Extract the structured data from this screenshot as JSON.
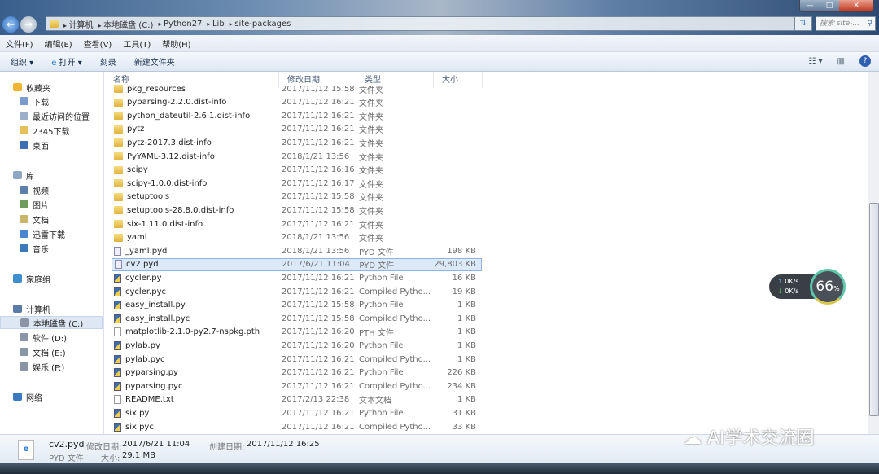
{
  "window": {
    "controls": [
      "minimize",
      "maximize",
      "close"
    ]
  },
  "address": {
    "segments": [
      "计算机",
      "本地磁盘 (C:)",
      "Python27",
      "Lib",
      "site-packages"
    ],
    "search_placeholder": "搜索 site-..."
  },
  "menu": [
    "文件(F)",
    "编辑(E)",
    "查看(V)",
    "工具(T)",
    "帮助(H)"
  ],
  "toolbar": {
    "organize": "组织 ▾",
    "open": "打开 ▾",
    "burn": "刻录",
    "new_folder": "新建文件夹"
  },
  "sidebar": [
    {
      "label": "收藏夹",
      "icon": "star-icon",
      "color": "#f2b531"
    },
    {
      "label": "下载",
      "icon": "download-folder-icon",
      "color": "#7a9ccc",
      "indent": true
    },
    {
      "label": "最近访问的位置",
      "icon": "recent-places-icon",
      "color": "#9aaecb",
      "indent": true
    },
    {
      "label": "2345下载",
      "icon": "folder-icon",
      "color": "#e7c157",
      "indent": true
    },
    {
      "label": "桌面",
      "icon": "desktop-icon",
      "color": "#3a6fb5",
      "indent": true
    },
    {
      "label": "库",
      "icon": "library-icon",
      "color": "#8fa7c5"
    },
    {
      "label": "视频",
      "icon": "video-icon",
      "color": "#5b7fae",
      "indent": true
    },
    {
      "label": "图片",
      "icon": "pictures-icon",
      "color": "#6f9b5a",
      "indent": true
    },
    {
      "label": "文档",
      "icon": "documents-icon",
      "color": "#c9b46a",
      "indent": true
    },
    {
      "label": "迅雷下载",
      "icon": "thunder-download-icon",
      "color": "#4a86cf",
      "indent": true
    },
    {
      "label": "音乐",
      "icon": "music-icon",
      "color": "#3b78c2",
      "indent": true
    },
    {
      "label": "家庭组",
      "icon": "homegroup-icon",
      "color": "#3f8fd0"
    },
    {
      "label": "计算机",
      "icon": "computer-icon",
      "color": "#5a7ca6"
    },
    {
      "label": "本地磁盘 (C:)",
      "icon": "drive-icon",
      "color": "#8a96a6",
      "indent": true,
      "selected": true
    },
    {
      "label": "软件 (D:)",
      "icon": "drive-icon",
      "color": "#8a96a6",
      "indent": true
    },
    {
      "label": "文档 (E:)",
      "icon": "drive-icon",
      "color": "#8a96a6",
      "indent": true
    },
    {
      "label": "娱乐 (F:)",
      "icon": "drive-icon",
      "color": "#8a96a6",
      "indent": true
    },
    {
      "label": "网络",
      "icon": "network-icon",
      "color": "#3a78c0"
    }
  ],
  "columns": [
    "名称",
    "修改日期",
    "类型",
    "大小"
  ],
  "files": [
    {
      "name": "pkg_resources",
      "date": "2017/11/12 15:58",
      "type": "文件夹",
      "size": "",
      "kind": "folder"
    },
    {
      "name": "pyparsing-2.2.0.dist-info",
      "date": "2017/11/12 16:21",
      "type": "文件夹",
      "size": "",
      "kind": "folder"
    },
    {
      "name": "python_dateutil-2.6.1.dist-info",
      "date": "2017/11/12 16:21",
      "type": "文件夹",
      "size": "",
      "kind": "folder"
    },
    {
      "name": "pytz",
      "date": "2017/11/12 16:21",
      "type": "文件夹",
      "size": "",
      "kind": "folder"
    },
    {
      "name": "pytz-2017.3.dist-info",
      "date": "2017/11/12 16:21",
      "type": "文件夹",
      "size": "",
      "kind": "folder"
    },
    {
      "name": "PyYAML-3.12.dist-info",
      "date": "2018/1/21 13:56",
      "type": "文件夹",
      "size": "",
      "kind": "folder"
    },
    {
      "name": "scipy",
      "date": "2017/11/12 16:16",
      "type": "文件夹",
      "size": "",
      "kind": "folder"
    },
    {
      "name": "scipy-1.0.0.dist-info",
      "date": "2017/11/12 16:17",
      "type": "文件夹",
      "size": "",
      "kind": "folder"
    },
    {
      "name": "setuptools",
      "date": "2017/11/12 15:58",
      "type": "文件夹",
      "size": "",
      "kind": "folder"
    },
    {
      "name": "setuptools-28.8.0.dist-info",
      "date": "2017/11/12 15:58",
      "type": "文件夹",
      "size": "",
      "kind": "folder"
    },
    {
      "name": "six-1.11.0.dist-info",
      "date": "2017/11/12 16:21",
      "type": "文件夹",
      "size": "",
      "kind": "folder"
    },
    {
      "name": "yaml",
      "date": "2018/1/21 13:56",
      "type": "文件夹",
      "size": "",
      "kind": "folder"
    },
    {
      "name": "_yaml.pyd",
      "date": "2018/1/21 13:56",
      "type": "PYD 文件",
      "size": "198 KB",
      "kind": "pyd"
    },
    {
      "name": "cv2.pyd",
      "date": "2017/6/21 11:04",
      "type": "PYD 文件",
      "size": "29,803 KB",
      "kind": "pyd",
      "selected": true
    },
    {
      "name": "cycler.py",
      "date": "2017/11/12 16:21",
      "type": "Python File",
      "size": "16 KB",
      "kind": "py"
    },
    {
      "name": "cycler.pyc",
      "date": "2017/11/12 16:21",
      "type": "Compiled Pytho...",
      "size": "19 KB",
      "kind": "py"
    },
    {
      "name": "easy_install.py",
      "date": "2017/11/12 15:58",
      "type": "Python File",
      "size": "1 KB",
      "kind": "py"
    },
    {
      "name": "easy_install.pyc",
      "date": "2017/11/12 15:58",
      "type": "Compiled Pytho...",
      "size": "1 KB",
      "kind": "py"
    },
    {
      "name": "matplotlib-2.1.0-py2.7-nspkg.pth",
      "date": "2017/11/12 16:20",
      "type": "PTH 文件",
      "size": "1 KB",
      "kind": "file"
    },
    {
      "name": "pylab.py",
      "date": "2017/11/12 16:20",
      "type": "Python File",
      "size": "1 KB",
      "kind": "py"
    },
    {
      "name": "pylab.pyc",
      "date": "2017/11/12 16:21",
      "type": "Compiled Pytho...",
      "size": "1 KB",
      "kind": "py"
    },
    {
      "name": "pyparsing.py",
      "date": "2017/11/12 16:21",
      "type": "Python File",
      "size": "226 KB",
      "kind": "py"
    },
    {
      "name": "pyparsing.pyc",
      "date": "2017/11/12 16:21",
      "type": "Compiled Pytho...",
      "size": "234 KB",
      "kind": "py"
    },
    {
      "name": "README.txt",
      "date": "2017/2/13 22:38",
      "type": "文本文档",
      "size": "1 KB",
      "kind": "file"
    },
    {
      "name": "six.py",
      "date": "2017/11/12 16:21",
      "type": "Python File",
      "size": "31 KB",
      "kind": "py"
    },
    {
      "name": "six.pyc",
      "date": "2017/11/12 16:21",
      "type": "Compiled Pytho...",
      "size": "33 KB",
      "kind": "py"
    }
  ],
  "details": {
    "name": "cv2.pyd",
    "modified_label": "修改日期:",
    "modified": "2017/6/21 11:04",
    "created_label": "创建日期:",
    "created": "2017/11/12 16:25",
    "type": "PYD 文件",
    "size_label": "大小:",
    "size": "29.1 MB"
  },
  "net_widget": {
    "up": "0K/s",
    "down": "0K/s",
    "percent": "66",
    "percent_unit": "%"
  },
  "watermark": "AI学术交流圈"
}
